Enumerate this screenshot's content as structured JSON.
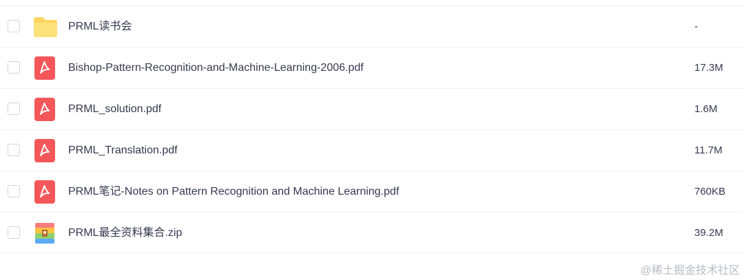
{
  "files": [
    {
      "name": "PRML读书会",
      "size": "-",
      "icon": "folder-icon"
    },
    {
      "name": "Bishop-Pattern-Recognition-and-Machine-Learning-2006.pdf",
      "size": "17.3M",
      "icon": "pdf-icon"
    },
    {
      "name": "PRML_solution.pdf",
      "size": "1.6M",
      "icon": "pdf-icon"
    },
    {
      "name": "PRML_Translation.pdf",
      "size": "11.7M",
      "icon": "pdf-icon"
    },
    {
      "name": "PRML笔记-Notes on Pattern Recognition and Machine Learning.pdf",
      "size": "760KB",
      "icon": "pdf-icon"
    },
    {
      "name": "PRML最全资料集合.zip",
      "size": "39.2M",
      "icon": "zip-icon"
    }
  ],
  "colors": {
    "folder": "#fcd561",
    "pdf": "#f4575a",
    "text": "#333a4d",
    "divider": "#eef0f4"
  },
  "watermark": "@稀土掘金技术社区"
}
